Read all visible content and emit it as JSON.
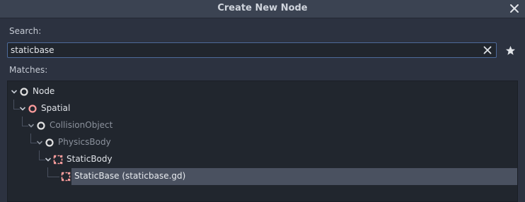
{
  "dialog": {
    "title": "Create New Node",
    "close_icon": "close-icon"
  },
  "search": {
    "label": "Search:",
    "value": "staticbase",
    "clear_icon": "clear-icon",
    "favorite_icon": "star-icon"
  },
  "matches": {
    "label": "Matches:",
    "tree": [
      {
        "label": "Node",
        "icon": "node-circle-icon",
        "icon_color": "#e0e0e0",
        "text_color": "#e0e3e8",
        "expanded": true
      },
      {
        "label": "Spatial",
        "icon": "spatial-circle-icon",
        "icon_color": "#fc9c9c",
        "text_color": "#e0e3e8",
        "expanded": true
      },
      {
        "label": "CollisionObject",
        "icon": "collision-object-circle-icon",
        "icon_color": "#e0e0e0",
        "text_color": "#8b919c",
        "expanded": true
      },
      {
        "label": "PhysicsBody",
        "icon": "physics-body-circle-icon",
        "icon_color": "#e0e0e0",
        "text_color": "#8b919c",
        "expanded": true
      },
      {
        "label": "StaticBody",
        "icon": "static-body-icon",
        "icon_color": "#fc9c9c",
        "text_color": "#e0e3e8",
        "expanded": true
      },
      {
        "label": "StaticBase (staticbase.gd)",
        "icon": "static-body-icon",
        "icon_color": "#fc9c9c",
        "text_color": "#e8ebef",
        "selected": true
      }
    ]
  }
}
